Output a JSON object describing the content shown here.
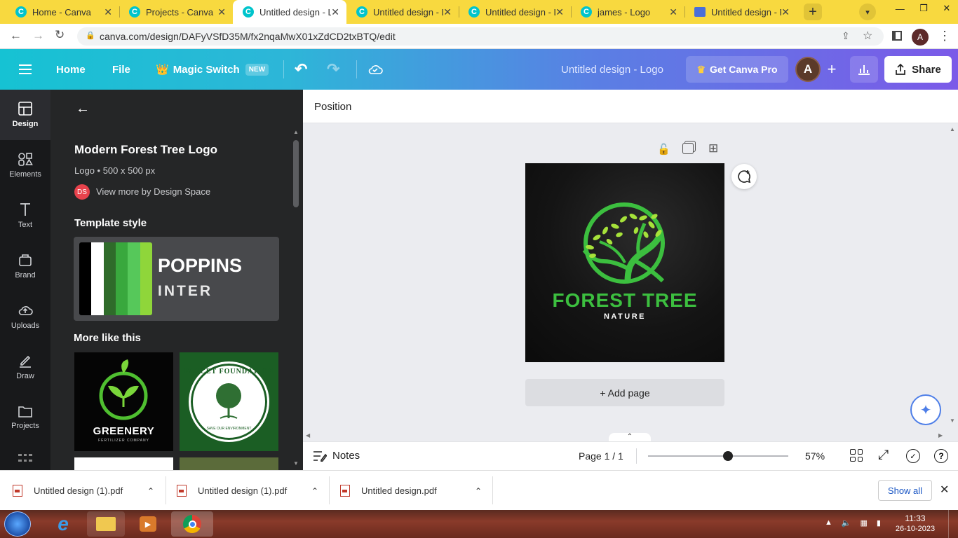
{
  "browser": {
    "tabs": [
      {
        "title": "Home - Canva",
        "favicon": "canva-icon"
      },
      {
        "title": "Projects - Canva",
        "favicon": "canva-icon"
      },
      {
        "title": "Untitled design - L",
        "favicon": "canva-icon",
        "active": true
      },
      {
        "title": "Untitled design - L",
        "favicon": "canva-icon"
      },
      {
        "title": "Untitled design - L",
        "favicon": "canva-icon"
      },
      {
        "title": "james - Logo",
        "favicon": "canva-icon"
      },
      {
        "title": "Untitled design - P",
        "favicon": "print-icon"
      }
    ],
    "url": "canva.com/design/DAFyVSfD35M/fx2nqaMwX01xZdCD2txBTQ/edit",
    "profile_initial": "A"
  },
  "header": {
    "home": "Home",
    "file": "File",
    "magic_switch": "Magic Switch",
    "new_badge": "NEW",
    "design_title": "Untitled design - Logo",
    "get_pro": "Get Canva Pro",
    "avatar_initial": "A",
    "share": "Share"
  },
  "rail": [
    {
      "label": "Design",
      "icon": "design-icon"
    },
    {
      "label": "Elements",
      "icon": "elements-icon"
    },
    {
      "label": "Text",
      "icon": "text-icon"
    },
    {
      "label": "Brand",
      "icon": "brand-icon"
    },
    {
      "label": "Uploads",
      "icon": "uploads-icon"
    },
    {
      "label": "Draw",
      "icon": "draw-icon"
    },
    {
      "label": "Projects",
      "icon": "projects-icon"
    }
  ],
  "panel": {
    "template_name": "Modern Forest Tree Logo",
    "template_meta": "Logo • 500 x 500 px",
    "creator_initials": "DS",
    "creator_link": "View more by Design Space",
    "template_style_heading": "Template style",
    "font_primary": "POPPINS",
    "font_secondary": "INTER",
    "swatches": [
      "#000000",
      "#ffffff",
      "#2f6b2a",
      "#39a83d",
      "#56c85a",
      "#8fd63a"
    ],
    "more_like_this": "More like this",
    "thumbs": [
      {
        "title": "GREENERY",
        "subtitle": "FERTILIZER COMPANY"
      },
      {
        "title": "FAUCET FOUNDATION",
        "subtitle": "SAVE OUR ENVIRONMENT"
      }
    ]
  },
  "toolbar": {
    "position": "Position"
  },
  "canvas": {
    "logo_title": "FOREST TREE",
    "logo_subtitle": "NATURE",
    "add_page": "+ Add page",
    "colors": {
      "bg": "#121212",
      "green": "#3cbf3f",
      "leaf": "#a6e23a"
    }
  },
  "footer": {
    "notes": "Notes",
    "page": "Page 1 / 1",
    "zoom_percent": 57,
    "zoom_label": "57%"
  },
  "downloads": [
    {
      "name": "Untitled design (1).pdf"
    },
    {
      "name": "Untitled design (1).pdf"
    },
    {
      "name": "Untitled design.pdf"
    }
  ],
  "downloads_show_all": "Show all",
  "taskbar": {
    "time": "11:33",
    "date": "26-10-2023"
  }
}
